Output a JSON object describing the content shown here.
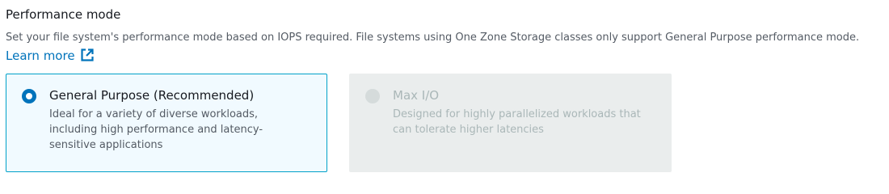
{
  "performance_mode": {
    "label": "Performance mode",
    "description": "Set your file system's performance mode based on IOPS required. File systems using One Zone Storage classes only support General Purpose performance mode.",
    "learn_more_label": "Learn more",
    "learn_more_icon": "external-link-icon",
    "options": [
      {
        "title": "General Purpose (Recommended)",
        "description": "Ideal for a variety of diverse workloads, including high performance and latency-sensitive applications",
        "selected": true,
        "disabled": false
      },
      {
        "title": "Max I/O",
        "description": "Designed for highly parallelized workloads that can tolerate higher latencies",
        "selected": false,
        "disabled": true
      }
    ]
  },
  "colors": {
    "accent": "#0073bb",
    "selected_border": "#00a1c9",
    "selected_background": "#f1faff",
    "disabled_background": "#eaeded",
    "disabled_text": "#aab7b8"
  }
}
